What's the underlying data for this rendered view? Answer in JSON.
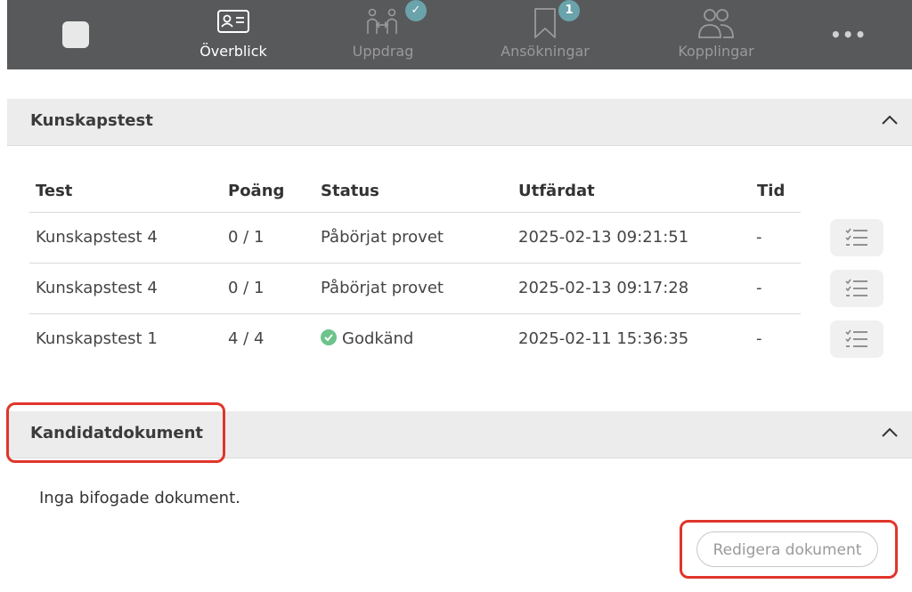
{
  "nav": {
    "items": [
      {
        "label": "Överblick",
        "icon": "id-card-icon",
        "active": true
      },
      {
        "label": "Uppdrag",
        "icon": "people-handshake-icon",
        "badge": "✓"
      },
      {
        "label": "Ansökningar",
        "icon": "bookmark-icon",
        "badge": "1"
      },
      {
        "label": "Kopplingar",
        "icon": "users-icon"
      }
    ],
    "more_label": "•••"
  },
  "tests_section": {
    "title": "Kunskapstest",
    "columns": [
      "Test",
      "Poäng",
      "Status",
      "Utfärdat",
      "Tid"
    ],
    "rows": [
      {
        "test": "Kunskapstest 4",
        "score": "0 / 1",
        "status": "Påbörjat provet",
        "issued": "2025-02-13 09:21:51",
        "time": "-"
      },
      {
        "test": "Kunskapstest 4",
        "score": "0 / 1",
        "status": "Påbörjat provet",
        "issued": "2025-02-13 09:17:28",
        "time": "-"
      },
      {
        "test": "Kunskapstest 1",
        "score": "4 / 4",
        "status": "Godkänd",
        "issued": "2025-02-11 15:36:35",
        "time": "-"
      }
    ]
  },
  "documents_section": {
    "title": "Kandidatdokument",
    "empty_text": "Inga bifogade dokument.",
    "edit_button": "Redigera dokument"
  },
  "colors": {
    "nav_bg": "#58595b",
    "badge": "#6aa3ab",
    "success": "#6cc48a",
    "highlight": "#e0352b"
  }
}
